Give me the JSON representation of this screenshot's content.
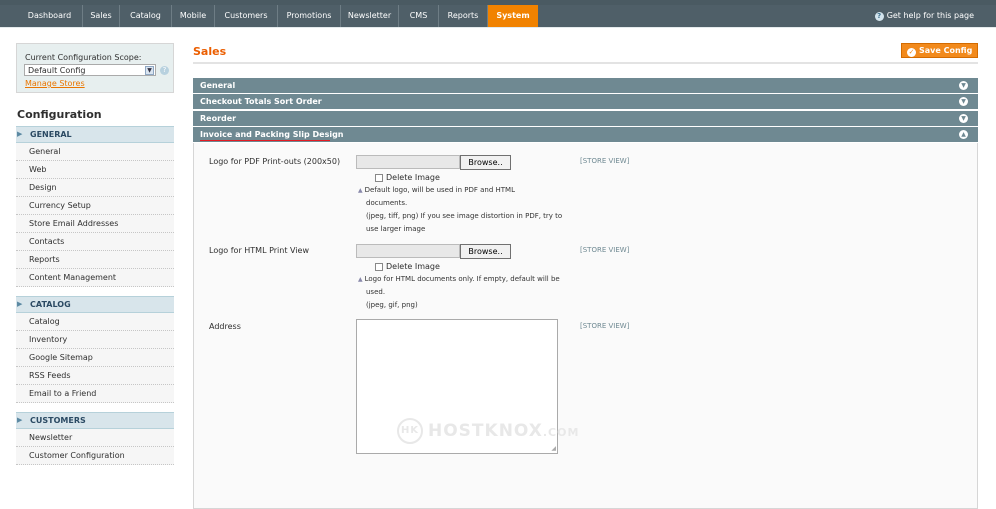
{
  "nav": {
    "tabs": [
      "Dashboard",
      "Sales",
      "Catalog",
      "Mobile",
      "Customers",
      "Promotions",
      "Newsletter",
      "CMS",
      "Reports",
      "System"
    ],
    "active_tab": "System",
    "help": "Get help for this page"
  },
  "sidebar": {
    "scope_label": "Current Configuration Scope:",
    "scope_value": "Default Config",
    "manage_stores": "Manage Stores",
    "title": "Configuration",
    "groups": [
      {
        "title": "GENERAL",
        "items": [
          "General",
          "Web",
          "Design",
          "Currency Setup",
          "Store Email Addresses",
          "Contacts",
          "Reports",
          "Content Management"
        ]
      },
      {
        "title": "CATALOG",
        "items": [
          "Catalog",
          "Inventory",
          "Google Sitemap",
          "RSS Feeds",
          "Email to a Friend"
        ]
      },
      {
        "title": "CUSTOMERS",
        "items": [
          "Newsletter",
          "Customer Configuration"
        ]
      }
    ]
  },
  "main": {
    "title": "Sales",
    "save_button": "Save Config",
    "sections": [
      "General",
      "Checkout Totals Sort Order",
      "Reorder",
      "Invoice and Packing Slip Design"
    ],
    "fields": {
      "logo_pdf": {
        "label": "Logo for PDF Print-outs (200x50)",
        "browse": "Browse..",
        "delete": "Delete Image",
        "note1": "Default logo, will be used in PDF and HTML",
        "note2": "documents.",
        "note3": "(jpeg, tiff, png) If you see image distortion in PDF, try to",
        "note4": "use larger image",
        "scope": "[STORE VIEW]"
      },
      "logo_html": {
        "label": "Logo for HTML Print View",
        "browse": "Browse..",
        "delete": "Delete Image",
        "note1": "Logo for HTML documents only. If empty, default will be",
        "note2": "used.",
        "note3": "(jpeg, gif, png)",
        "scope": "[STORE VIEW]"
      },
      "address": {
        "label": "Address",
        "scope": "[STORE VIEW]"
      }
    }
  },
  "watermark": {
    "text": "HOSTKNOX",
    "suffix": ".COM"
  }
}
